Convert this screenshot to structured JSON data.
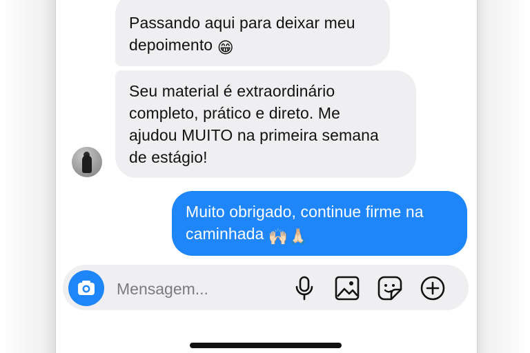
{
  "messages": [
    {
      "direction": "incoming",
      "lines": [
        "Passando aqui para deixar meu",
        "depoimento"
      ],
      "emoji": "😁"
    },
    {
      "direction": "incoming",
      "lines": [
        "Seu material é extraordinário",
        "completo, prático e direto. Me",
        "ajudou MUITO na primeira semana",
        "de estágio!"
      ]
    },
    {
      "direction": "outgoing",
      "lines": [
        "Muito obrigado, continue firme na",
        "caminhada"
      ],
      "emoji": "🙌🏻🙏🏻"
    }
  ],
  "composer": {
    "placeholder": "Mensagem...",
    "icons": [
      "camera-icon",
      "microphone-icon",
      "gallery-icon",
      "sticker-icon",
      "add-circle-icon"
    ]
  },
  "colors": {
    "accent": "#1e86f8",
    "incoming_bubble": "#efeff1",
    "outgoing_text": "#ffffff",
    "placeholder": "#7b7b7f"
  }
}
